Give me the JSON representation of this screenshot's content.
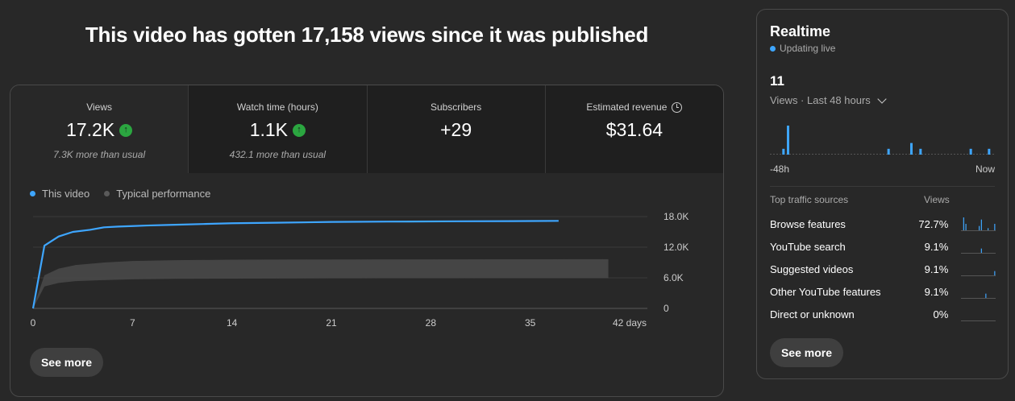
{
  "headline": "This video has gotten 17,158 views since it was published",
  "metrics": [
    {
      "label": "Views",
      "value": "17.2K",
      "trend": "up",
      "sub": "7.3K more than usual"
    },
    {
      "label": "Watch time (hours)",
      "value": "1.1K",
      "trend": "up",
      "sub": "432.1 more than usual"
    },
    {
      "label": "Subscribers",
      "value": "+29",
      "trend": "",
      "sub": ""
    },
    {
      "label": "Estimated revenue",
      "value": "$31.64",
      "trend": "",
      "sub": ""
    }
  ],
  "legend": {
    "this_video": "This video",
    "typical": "Typical performance"
  },
  "see_more": "See more",
  "colors": {
    "accent": "#3ea6ff",
    "up": "#2ba640",
    "typical_band": "#4a4a4a"
  },
  "chart_data": {
    "type": "line",
    "x_tick_labels": [
      "0",
      "7",
      "14",
      "21",
      "28",
      "35",
      "42 days"
    ],
    "x_ticks": [
      0,
      7,
      14,
      21,
      28,
      35,
      42
    ],
    "y_tick_labels": [
      "18.0K",
      "12.0K",
      "6.0K",
      "0"
    ],
    "y_ticks": [
      18000,
      12000,
      6000,
      0
    ],
    "xlim": [
      0,
      42
    ],
    "ylim": [
      0,
      18000
    ],
    "series": [
      {
        "name": "This video",
        "x": [
          0,
          0.8,
          1.8,
          2.8,
          4,
          5,
          6,
          7,
          8,
          10,
          12,
          14,
          17,
          21,
          25,
          30,
          35,
          37
        ],
        "values": [
          0,
          12300,
          14100,
          15000,
          15400,
          15900,
          16050,
          16150,
          16250,
          16400,
          16550,
          16700,
          16800,
          16950,
          17020,
          17080,
          17130,
          17158
        ]
      }
    ],
    "typical_band": {
      "x": [
        0,
        0.8,
        1.8,
        3,
        5,
        7,
        10,
        14,
        21,
        28,
        35,
        40.5
      ],
      "low": [
        0,
        4300,
        5000,
        5350,
        5550,
        5700,
        5800,
        5850,
        5900,
        5920,
        5940,
        5950
      ],
      "high": [
        0,
        6500,
        7800,
        8500,
        9000,
        9300,
        9450,
        9550,
        9600,
        9620,
        9640,
        9650
      ]
    },
    "grid": true,
    "legend_position": "top-left"
  },
  "realtime": {
    "title": "Realtime",
    "live": "Updating live",
    "count": "11",
    "range": "Views · Last 48 hours",
    "axis_start": "-48h",
    "axis_end": "Now",
    "bars": [
      0,
      0,
      1,
      5,
      0,
      0,
      0,
      0,
      0,
      0,
      0,
      0,
      0,
      0,
      0,
      0,
      0,
      0,
      0,
      0,
      0,
      0,
      0,
      0,
      0,
      1,
      0,
      0,
      0,
      0,
      2,
      0,
      1,
      0,
      0,
      0,
      0,
      0,
      0,
      0,
      0,
      0,
      0,
      1,
      0,
      0,
      0,
      1
    ],
    "traffic_header": "Top traffic sources",
    "traffic_views_header": "Views",
    "traffic": [
      {
        "name": "Browse features",
        "pct": "72.7%",
        "spark": [
          0,
          6,
          3,
          0,
          0,
          0,
          0,
          0,
          2,
          5,
          0,
          0,
          1,
          0,
          0,
          3
        ]
      },
      {
        "name": "YouTube search",
        "pct": "9.1%",
        "spark": [
          0,
          0,
          0,
          0,
          0,
          0,
          0,
          0,
          0,
          2,
          0,
          0,
          0,
          0,
          0,
          0
        ]
      },
      {
        "name": "Suggested videos",
        "pct": "9.1%",
        "spark": [
          0,
          0,
          0,
          0,
          0,
          0,
          0,
          0,
          0,
          0,
          0,
          0,
          0,
          0,
          0,
          2
        ]
      },
      {
        "name": "Other YouTube features",
        "pct": "9.1%",
        "spark": [
          0,
          0,
          0,
          0,
          0,
          0,
          0,
          0,
          0,
          0,
          0,
          2,
          0,
          0,
          0,
          0
        ]
      },
      {
        "name": "Direct or unknown",
        "pct": "0%",
        "spark": [
          0,
          0,
          0,
          0,
          0,
          0,
          0,
          0,
          0,
          0,
          0,
          0,
          0,
          0,
          0,
          0
        ]
      }
    ],
    "see_more": "See more"
  }
}
